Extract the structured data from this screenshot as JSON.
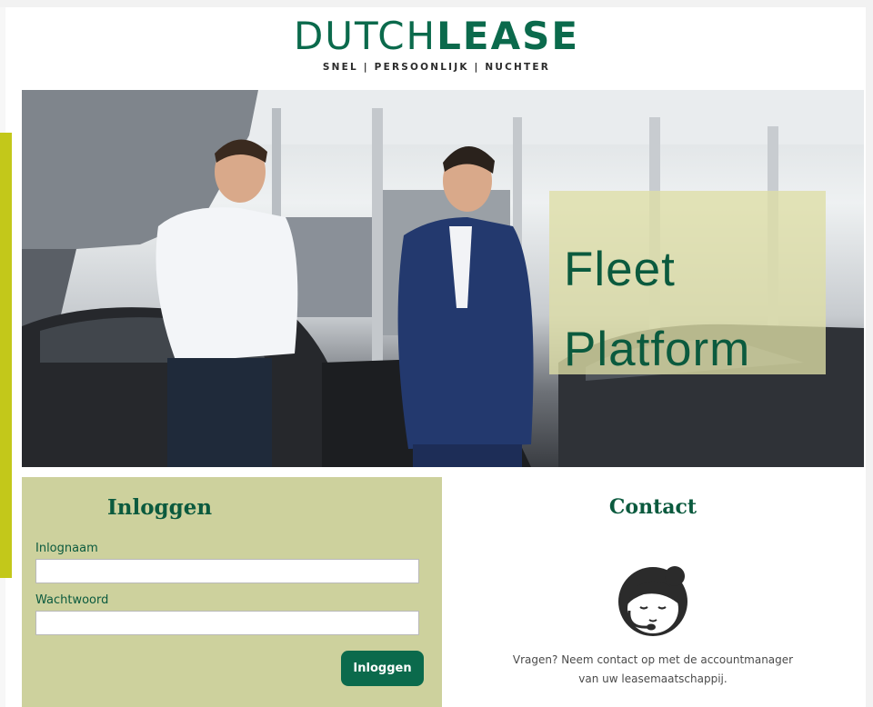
{
  "brand": {
    "name_light": "DUTCH",
    "name_bold": "LEASE",
    "tagline": "SNEL | PERSOONLIJK | NUCHTER",
    "color": "#0b6a4c"
  },
  "hero": {
    "line1": "Fleet",
    "line2": "Platform"
  },
  "login": {
    "title": "Inloggen",
    "username_label": "Inlognaam",
    "username_value": "",
    "password_label": "Wachtwoord",
    "password_value": "",
    "button_label": "Inloggen"
  },
  "contact": {
    "title": "Contact",
    "icon": "customer-service-agent-icon",
    "text_line1": "Vragen? Neem contact op met de accountmanager",
    "text_line2": "van uw leasemaatschappij."
  },
  "colors": {
    "accent_green": "#0b6a4c",
    "panel_olive": "#cdd19d",
    "side_accent": "#c3c81a"
  }
}
